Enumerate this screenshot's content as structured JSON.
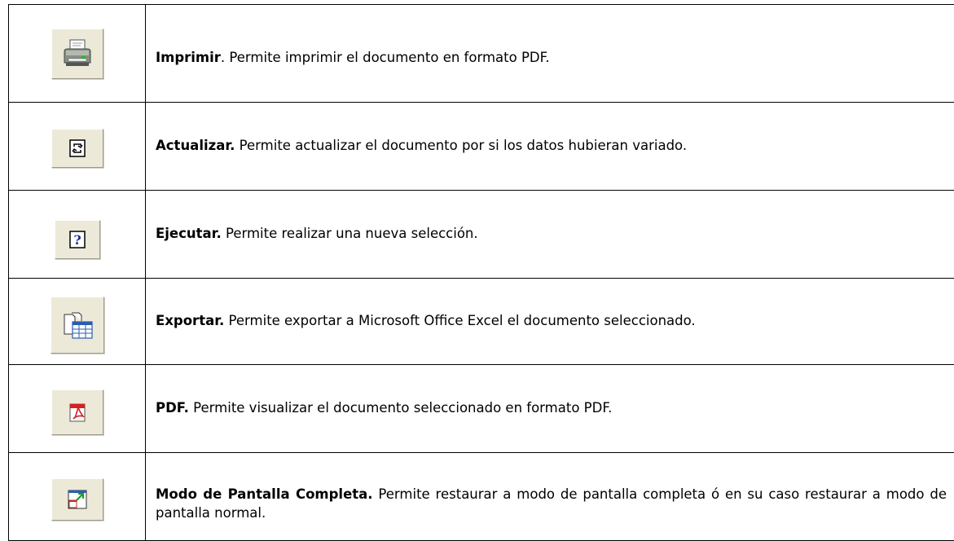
{
  "rows": [
    {
      "icon": "printer-icon",
      "title": "Imprimir",
      "text": ". Permite imprimir el documento en formato PDF."
    },
    {
      "icon": "refresh-icon",
      "title": "Actualizar.",
      "text": " Permite actualizar el documento por si los datos hubieran variado."
    },
    {
      "icon": "help-icon",
      "title": "Ejecutar.",
      "text": " Permite realizar una nueva selección."
    },
    {
      "icon": "export-excel-icon",
      "title": "Exportar.",
      "text": " Permite exportar a Microsoft Office Excel el documento seleccionado."
    },
    {
      "icon": "pdf-icon",
      "title": "PDF.",
      "text": " Permite visualizar el documento seleccionado en formato PDF."
    },
    {
      "icon": "fullscreen-icon",
      "title": "Modo de Pantalla Completa.",
      "text": " Permite restaurar a modo de pantalla completa ó en su caso restaurar a modo de pantalla normal."
    }
  ]
}
